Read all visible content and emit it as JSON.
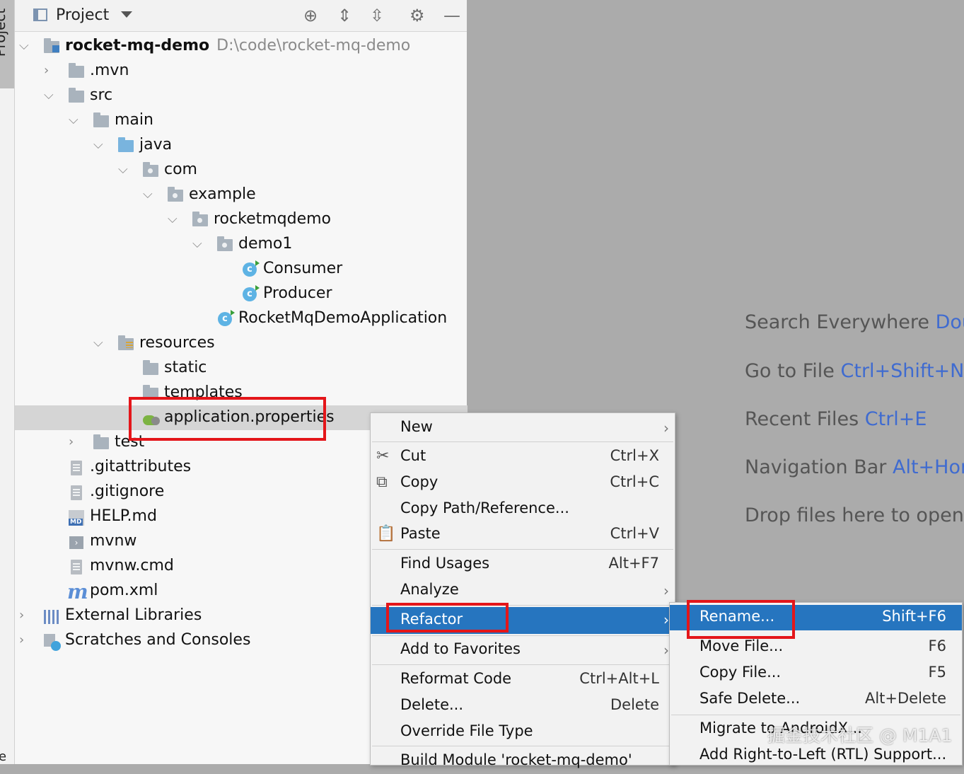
{
  "side_stripe": {
    "tab_label": "Project",
    "bottom_label": "e"
  },
  "toolbar": {
    "title": "Project",
    "icons": [
      "locate-icon",
      "expand-all-icon",
      "collapse-all-icon",
      "gear-icon",
      "minimize-icon"
    ]
  },
  "tree": [
    {
      "label": "rocket-mq-demo",
      "path": "D:\\code\\rocket-mq-demo",
      "icon": "module-folder",
      "expanded": true
    },
    {
      "label": ".mvn",
      "icon": "folder",
      "expanded": false
    },
    {
      "label": "src",
      "icon": "folder",
      "expanded": true
    },
    {
      "label": "main",
      "icon": "folder",
      "expanded": true
    },
    {
      "label": "java",
      "icon": "source-folder",
      "expanded": true
    },
    {
      "label": "com",
      "icon": "package",
      "expanded": true
    },
    {
      "label": "example",
      "icon": "package",
      "expanded": true
    },
    {
      "label": "rocketmqdemo",
      "icon": "package",
      "expanded": true
    },
    {
      "label": "demo1",
      "icon": "package",
      "expanded": true
    },
    {
      "label": "Consumer",
      "icon": "class"
    },
    {
      "label": "Producer",
      "icon": "class"
    },
    {
      "label": "RocketMqDemoApplication",
      "icon": "spring-class"
    },
    {
      "label": "resources",
      "icon": "resources-folder",
      "expanded": true
    },
    {
      "label": "static",
      "icon": "folder"
    },
    {
      "label": "templates",
      "icon": "folder"
    },
    {
      "label": "application.properties",
      "icon": "properties-file",
      "selected": true
    },
    {
      "label": "test",
      "icon": "folder",
      "expanded": false
    },
    {
      "label": ".gitattributes",
      "icon": "text-file"
    },
    {
      "label": ".gitignore",
      "icon": "ignore-file"
    },
    {
      "label": "HELP.md",
      "icon": "markdown-file"
    },
    {
      "label": "mvnw",
      "icon": "shell-file"
    },
    {
      "label": "mvnw.cmd",
      "icon": "text-file"
    },
    {
      "label": "pom.xml",
      "icon": "maven-file"
    },
    {
      "label": "External Libraries",
      "icon": "library",
      "expanded": false
    },
    {
      "label": "Scratches and Consoles",
      "icon": "scratches",
      "expanded": false
    }
  ],
  "editor_hints": [
    {
      "text": "Search Everywhere",
      "shortcut": "Dou"
    },
    {
      "text": "Go to File",
      "shortcut": "Ctrl+Shift+N"
    },
    {
      "text": "Recent Files",
      "shortcut": "Ctrl+E"
    },
    {
      "text": "Navigation Bar",
      "shortcut": "Alt+Hor"
    },
    {
      "text": "Drop files here to open",
      "shortcut": ""
    }
  ],
  "context_menu": [
    {
      "label": "New",
      "shortcut": "",
      "submenu": true
    },
    {
      "label": "Cut",
      "shortcut": "Ctrl+X",
      "icon": "cut-icon"
    },
    {
      "label": "Copy",
      "shortcut": "Ctrl+C",
      "icon": "copy-icon"
    },
    {
      "label": "Copy Path/Reference...",
      "shortcut": ""
    },
    {
      "label": "Paste",
      "shortcut": "Ctrl+V",
      "icon": "paste-icon"
    },
    {
      "label": "Find Usages",
      "shortcut": "Alt+F7"
    },
    {
      "label": "Analyze",
      "shortcut": "",
      "submenu": true
    },
    {
      "label": "Refactor",
      "shortcut": "",
      "submenu": true,
      "active": true
    },
    {
      "label": "Add to Favorites",
      "shortcut": "",
      "submenu": true
    },
    {
      "label": "Reformat Code",
      "shortcut": "Ctrl+Alt+L"
    },
    {
      "label": "Delete...",
      "shortcut": "Delete"
    },
    {
      "label": "Override File Type",
      "shortcut": ""
    },
    {
      "label": "Build Module 'rocket-mq-demo'",
      "shortcut": ""
    }
  ],
  "refactor_submenu": [
    {
      "label": "Rename...",
      "shortcut": "Shift+F6",
      "active": true
    },
    {
      "label": "Move File...",
      "shortcut": "F6"
    },
    {
      "label": "Copy File...",
      "shortcut": "F5"
    },
    {
      "label": "Safe Delete...",
      "shortcut": "Alt+Delete"
    },
    {
      "label": "Migrate to AndroidX...",
      "shortcut": ""
    },
    {
      "label": "Add Right-to-Left (RTL) Support...",
      "shortcut": ""
    }
  ],
  "watermark": "掘金技术社区 @ M1A1",
  "colors": {
    "highlight_box": "#e4161a",
    "menu_active": "#2675bf",
    "shortcut_hint": "#3f6bd0"
  }
}
